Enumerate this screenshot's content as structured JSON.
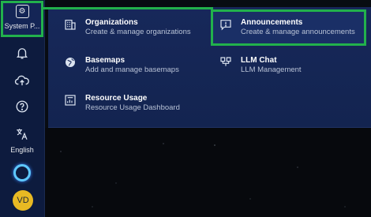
{
  "sidebar": {
    "system_label": "System P...",
    "language_label": "English",
    "avatar_initials": "VD",
    "icons": [
      "system-icon",
      "bell-icon",
      "cloud-upload-icon",
      "help-icon",
      "translate-icon",
      "status-ring-icon",
      "avatar"
    ]
  },
  "menu": {
    "items": [
      {
        "title": "Organizations",
        "desc": "Create & manage organizations",
        "icon": "building-icon"
      },
      {
        "title": "Announcements",
        "desc": "Create & manage announcements",
        "icon": "announcement-icon"
      },
      {
        "title": "Basemaps",
        "desc": "Add and manage basemaps",
        "icon": "globe-icon"
      },
      {
        "title": "LLM Chat",
        "desc": "LLM Management",
        "icon": "chat-icon"
      },
      {
        "title": "Resource Usage",
        "desc": "Resource Usage Dashboard",
        "icon": "dashboard-icon"
      }
    ]
  },
  "colors": {
    "sidebar_bg": "#0d1b3e",
    "panel_bg": "#17285a",
    "highlight_outline": "#22b14c",
    "avatar_bg": "#e8b923",
    "ring": "#5ec8ff"
  }
}
